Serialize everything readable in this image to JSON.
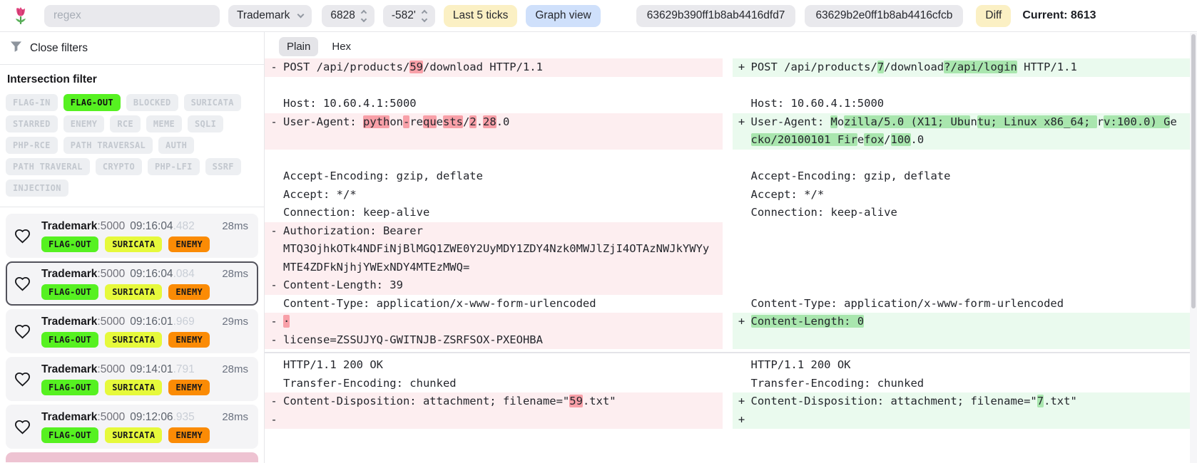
{
  "topbar": {
    "search_placeholder": "regex",
    "service_select": "Trademark",
    "tick_value": "6828",
    "offset_value": "-582'",
    "last_ticks_label": "Last 5 ticks",
    "graph_view_label": "Graph view",
    "flow_id_1": "63629b390ff1b8ab4416dfd7",
    "flow_id_2": "63629b2e0ff1b8ab4416cfcb",
    "diff_label": "Diff",
    "current_label": "Current: 8613"
  },
  "sidebar": {
    "close_filters_label": "Close filters",
    "intersection_filter_title": "Intersection filter",
    "filter_tags": [
      {
        "label": "FLAG-IN",
        "active": false
      },
      {
        "label": "FLAG-OUT",
        "active": true
      },
      {
        "label": "BLOCKED",
        "active": false
      },
      {
        "label": "SURICATA",
        "active": false
      },
      {
        "label": "STARRED",
        "active": false
      },
      {
        "label": "ENEMY",
        "active": false
      },
      {
        "label": "RCE",
        "active": false
      },
      {
        "label": "MEME",
        "active": false
      },
      {
        "label": "SQLI",
        "active": false
      },
      {
        "label": "PHP-RCE",
        "active": false
      },
      {
        "label": "PATH TRAVERSAL",
        "active": false
      },
      {
        "label": "AUTH",
        "active": false
      },
      {
        "label": "PATH TRAVERAL",
        "active": false
      },
      {
        "label": "CRYPTO",
        "active": false
      },
      {
        "label": "PHP-LFI",
        "active": false
      },
      {
        "label": "SSRF",
        "active": false
      },
      {
        "label": "INJECTION",
        "active": false
      }
    ],
    "tag_colors": {
      "FLAG-OUT": "#56f121",
      "SURICATA": "#e6f93b",
      "ENEMY": "#fb8b05"
    },
    "flows": [
      {
        "service": "Trademark",
        "port": "5000",
        "time": "09:16:04",
        "time_ms": ".482",
        "duration": "28ms",
        "tags": [
          "FLAG-OUT",
          "SURICATA",
          "ENEMY"
        ],
        "selected": false
      },
      {
        "service": "Trademark",
        "port": "5000",
        "time": "09:16:04",
        "time_ms": ".084",
        "duration": "28ms",
        "tags": [
          "FLAG-OUT",
          "SURICATA",
          "ENEMY"
        ],
        "selected": true
      },
      {
        "service": "Trademark",
        "port": "5000",
        "time": "09:16:01",
        "time_ms": ".969",
        "duration": "29ms",
        "tags": [
          "FLAG-OUT",
          "SURICATA",
          "ENEMY"
        ],
        "selected": false
      },
      {
        "service": "Trademark",
        "port": "5000",
        "time": "09:14:01",
        "time_ms": ".791",
        "duration": "28ms",
        "tags": [
          "FLAG-OUT",
          "SURICATA",
          "ENEMY"
        ],
        "selected": false
      },
      {
        "service": "Trademark",
        "port": "5000",
        "time": "09:12:06",
        "time_ms": ".935",
        "duration": "28ms",
        "tags": [
          "FLAG-OUT",
          "SURICATA",
          "ENEMY"
        ],
        "selected": false
      }
    ]
  },
  "main": {
    "tabs": [
      {
        "label": "Plain",
        "active": true
      },
      {
        "label": "Hex",
        "active": false
      }
    ],
    "diff_rows": [
      {
        "left": {
          "marker": "-",
          "kind": "del",
          "segments": [
            [
              "POST /api/products/",
              0
            ],
            [
              "59",
              1
            ],
            [
              "/download HTTP/1.1",
              0
            ]
          ]
        },
        "right": {
          "marker": "+",
          "kind": "add",
          "segments": [
            [
              "POST /api/products/",
              0
            ],
            [
              "7",
              1
            ],
            [
              "/download",
              0
            ],
            [
              "?/api/login",
              1
            ],
            [
              " HTTP/1.1",
              0
            ]
          ]
        }
      },
      {
        "left": {
          "kind": "ctx",
          "segments": [
            [
              " ",
              0
            ]
          ]
        },
        "right": {
          "kind": "ctx",
          "segments": [
            [
              " ",
              0
            ]
          ]
        }
      },
      {
        "left": {
          "kind": "ctx",
          "segments": [
            [
              "Host: 10.60.4.1:5000",
              0
            ]
          ]
        },
        "right": {
          "kind": "ctx",
          "segments": [
            [
              "Host: 10.60.4.1:5000",
              0
            ]
          ]
        }
      },
      {
        "left": {
          "marker": "-",
          "kind": "del",
          "segments": [
            [
              "User-Agent: ",
              0
            ],
            [
              "pyth",
              1
            ],
            [
              "on",
              0
            ],
            [
              "-",
              1
            ],
            [
              "re",
              0
            ],
            [
              "qu",
              1
            ],
            [
              "e",
              0
            ],
            [
              "sts",
              1
            ],
            [
              "/",
              0
            ],
            [
              "2",
              1
            ],
            [
              ".",
              0
            ],
            [
              "28",
              1
            ],
            [
              ".0",
              0
            ]
          ]
        },
        "right": {
          "marker": "+",
          "kind": "add",
          "segments": [
            [
              "User-Agent: ",
              0
            ],
            [
              "M",
              1
            ],
            [
              "o",
              0
            ],
            [
              "zilla/5.0 (X11; Ubu",
              1
            ],
            [
              "n",
              0
            ],
            [
              "tu; Linux x86_64; ",
              1
            ],
            [
              "r",
              0
            ],
            [
              "v:100.0) G",
              1
            ],
            [
              "e",
              0
            ],
            [
              "cko/20100101 Fir",
              1
            ],
            [
              "e",
              0
            ],
            [
              "fox",
              1
            ],
            [
              "/",
              0
            ],
            [
              "100",
              1
            ],
            [
              ".0",
              0
            ]
          ]
        }
      },
      {
        "left": {
          "kind": "ctx",
          "segments": [
            [
              " ",
              0
            ]
          ]
        },
        "right": {
          "kind": "ctx",
          "segments": [
            [
              " ",
              0
            ]
          ]
        }
      },
      {
        "left": {
          "kind": "ctx",
          "segments": [
            [
              "Accept-Encoding: gzip, deflate",
              0
            ]
          ]
        },
        "right": {
          "kind": "ctx",
          "segments": [
            [
              "Accept-Encoding: gzip, deflate",
              0
            ]
          ]
        }
      },
      {
        "left": {
          "kind": "ctx",
          "segments": [
            [
              "Accept: */*",
              0
            ]
          ]
        },
        "right": {
          "kind": "ctx",
          "segments": [
            [
              "Accept: */*",
              0
            ]
          ]
        }
      },
      {
        "left": {
          "kind": "ctx",
          "segments": [
            [
              "Connection: keep-alive",
              0
            ]
          ]
        },
        "right": {
          "kind": "ctx",
          "segments": [
            [
              "Connection: keep-alive",
              0
            ]
          ]
        }
      },
      {
        "left": {
          "marker": "-",
          "kind": "del",
          "segments": [
            [
              "Authorization: Bearer\nMTQ3OjhkOTk4NDFiNjBlMGQ1ZWE0Y2UyMDY1ZDY4Nzk0MWJlZjI4OTAzNWJkYWYyMTE4ZDFkNjhjYWExNDY4MTEzMWQ=",
              0
            ]
          ]
        },
        "right": {
          "kind": "empty",
          "segments": []
        }
      },
      {
        "left": {
          "marker": "-",
          "kind": "del",
          "segments": [
            [
              "Content-Length: 39",
              0
            ]
          ]
        },
        "right": {
          "kind": "empty",
          "segments": []
        }
      },
      {
        "left": {
          "kind": "ctx",
          "segments": [
            [
              "Content-Type: application/x-www-form-urlencoded",
              0
            ]
          ]
        },
        "right": {
          "kind": "ctx",
          "segments": [
            [
              "Content-Type: application/x-www-form-urlencoded",
              0
            ]
          ]
        }
      },
      {
        "left": {
          "marker": "-",
          "kind": "del",
          "segments": [
            [
              "·",
              1
            ]
          ]
        },
        "right": {
          "marker": "+",
          "kind": "add",
          "segments": [
            [
              "Content-Length: 0",
              1
            ]
          ]
        }
      },
      {
        "left": {
          "marker": "-",
          "kind": "del",
          "segments": [
            [
              "license=ZSSUJYQ-GWITNJB-ZSRFSOX-PXEOHBA",
              0
            ]
          ]
        },
        "right": {
          "kind": "add",
          "segments": [
            [
              " ",
              0
            ]
          ]
        }
      },
      {
        "divider": true
      },
      {
        "left": {
          "kind": "ctx",
          "segments": [
            [
              "HTTP/1.1 200 OK",
              0
            ]
          ]
        },
        "right": {
          "kind": "ctx",
          "segments": [
            [
              "HTTP/1.1 200 OK",
              0
            ]
          ]
        }
      },
      {
        "left": {
          "kind": "ctx",
          "segments": [
            [
              "Transfer-Encoding: chunked",
              0
            ]
          ]
        },
        "right": {
          "kind": "ctx",
          "segments": [
            [
              "Transfer-Encoding: chunked",
              0
            ]
          ]
        }
      },
      {
        "left": {
          "marker": "-",
          "kind": "del",
          "segments": [
            [
              "Content-Disposition: attachment; filename=\"",
              0
            ],
            [
              "59",
              1
            ],
            [
              ".txt\"",
              0
            ]
          ]
        },
        "right": {
          "marker": "+",
          "kind": "add",
          "segments": [
            [
              "Content-Disposition: attachment; filename=\"",
              0
            ],
            [
              "7",
              1
            ],
            [
              ".txt\"",
              0
            ]
          ]
        }
      },
      {
        "left": {
          "marker": "-",
          "kind": "del",
          "segments": [
            [
              " ",
              0
            ]
          ]
        },
        "right": {
          "marker": "+",
          "kind": "add",
          "segments": [
            [
              " ",
              0
            ]
          ]
        }
      }
    ]
  },
  "colors": {
    "accent-yellow": "#fbf0c4",
    "accent-blue": "#cfe0fb",
    "flag-out-green": "#56f121",
    "suricata-yellow": "#e6f93b",
    "enemy-orange": "#fb8b05",
    "del-row": "#fdeef0",
    "del-hl": "#f8a0a8",
    "add-row": "#eafaee",
    "add-hl": "#a9e6ae",
    "chip-bg": "#edeff2",
    "chip-text": "#c3c8cf",
    "selected-border": "#52525b",
    "partial-flow-pink": "#eec3d2"
  }
}
